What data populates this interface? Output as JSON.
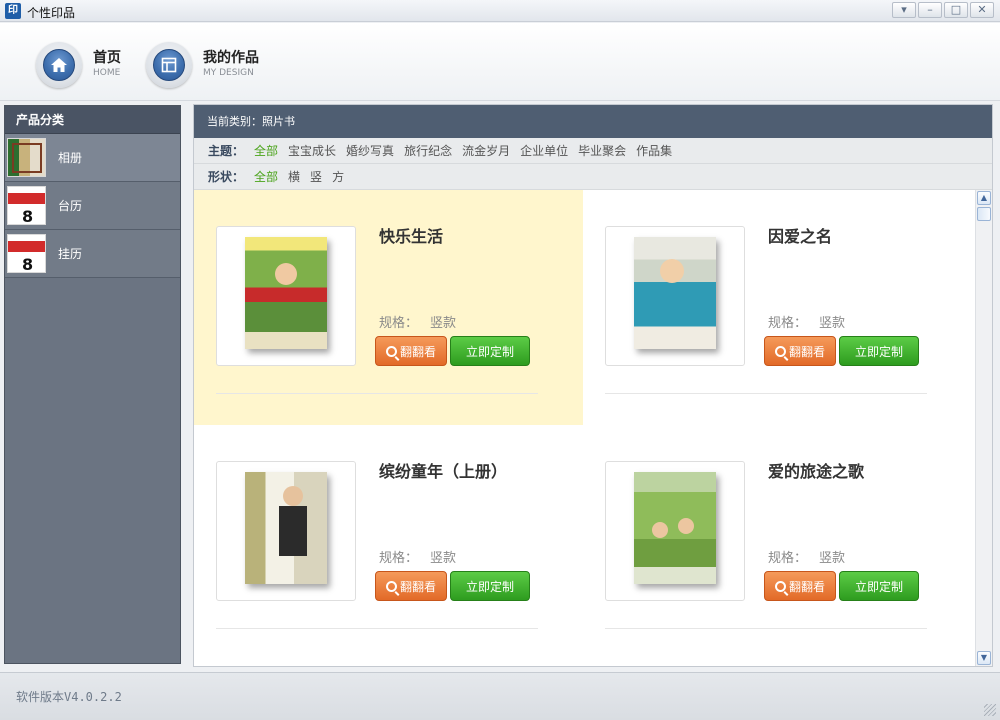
{
  "window": {
    "title": "个性印品",
    "app_icon_text": "印",
    "buttons": [
      "▾",
      "–",
      "□",
      "✕"
    ]
  },
  "topnav": {
    "home": {
      "label": "首页",
      "sub": "HOME",
      "icon": "home-icon"
    },
    "design": {
      "label": "我的作品",
      "sub": "MY DESIGN",
      "icon": "layout-icon"
    }
  },
  "sidebar": {
    "title": "产品分类",
    "items": [
      {
        "label": "相册",
        "icon": "album-thumbnail"
      },
      {
        "label": "台历",
        "icon": "desk-calendar-thumbnail"
      },
      {
        "label": "挂历",
        "icon": "wall-calendar-thumbnail"
      }
    ]
  },
  "main": {
    "crumb": "当前类别：照片书",
    "theme_filter": {
      "title": "主题：",
      "options": [
        "全部",
        "宝宝成长",
        "婚纱写真",
        "旅行纪念",
        "流金岁月",
        "企业单位",
        "毕业聚会",
        "作品集"
      ],
      "selected": "全部"
    },
    "shape_filter": {
      "title": "形状：",
      "options": [
        "全部",
        "横",
        "竖",
        "方"
      ],
      "selected": "全部"
    },
    "flip_label": "翻翻看",
    "buy_label": "立即定制",
    "spec_label": "规格：",
    "products": [
      {
        "title": "快乐生活",
        "spec": "竖款",
        "highlighted": true
      },
      {
        "title": "因爱之名",
        "spec": "竖款",
        "highlighted": false
      },
      {
        "title": "缤纷童年（上册）",
        "spec": "竖款",
        "highlighted": false
      },
      {
        "title": "爱的旅途之歌",
        "spec": "竖款",
        "highlighted": false
      }
    ]
  },
  "status": {
    "version": "软件版本V4.0.2.2"
  },
  "colors": {
    "header": "#4f5e72",
    "sidebar": "#6b7482",
    "selected_filter": "#4aa31a",
    "flip_button": "#e26a28",
    "buy_button": "#2e9c1f",
    "highlight": "#fff6cd"
  }
}
